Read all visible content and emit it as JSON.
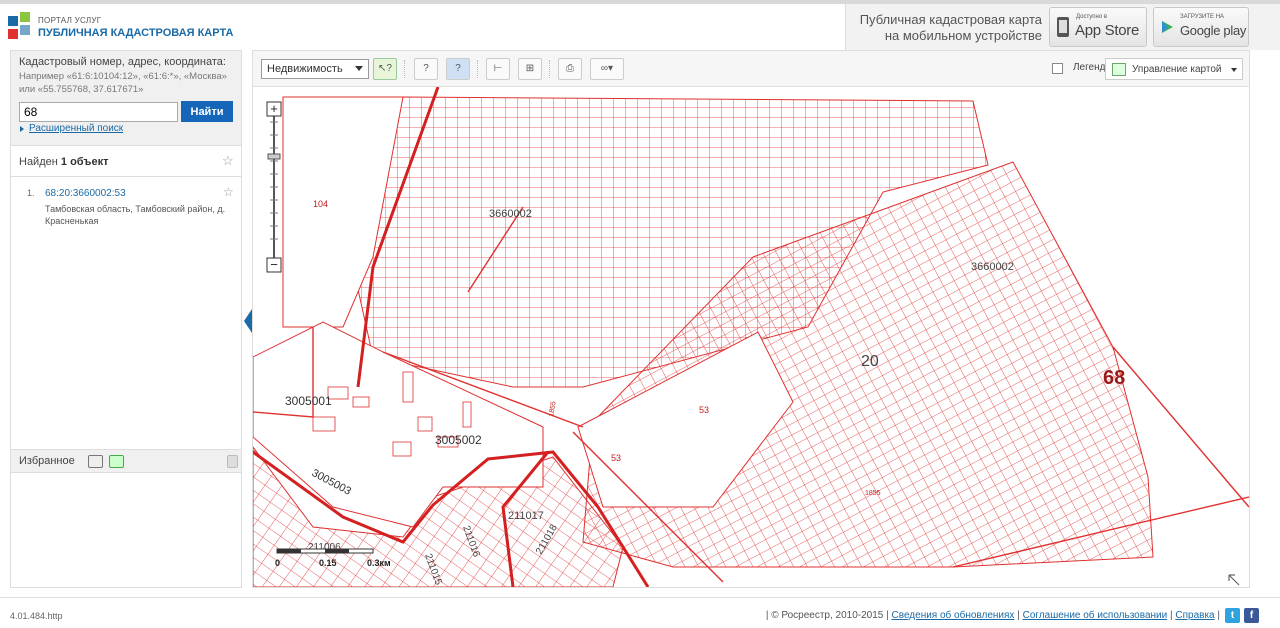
{
  "header": {
    "brand_line1": "ПОРТАЛ УСЛУГ",
    "brand_line2": "ПУБЛИЧНАЯ КАДАСТРОВАЯ КАРТА",
    "promo_text": "Публичная кадастровая карта на мобильном устройстве",
    "appstore_small": "Доступно в",
    "appstore_big": "App Store",
    "gplay_small": "ЗАГРУЗИТЕ НА",
    "gplay_big": "Google play"
  },
  "search": {
    "label": "Кадастровый номер, адрес, координата:",
    "example": "Например «61:6:10104:12», «61:6:*», «Москва» или «55.755768, 37.617671»",
    "value": "68",
    "button": "Найти",
    "advanced": "Расширенный поиск"
  },
  "results": {
    "found_prefix": "Найден",
    "found_count": "1 объект",
    "items": [
      {
        "num": "1.",
        "number": "68:20:3660002:53",
        "address": "Тамбовская область, Тамбовский район, д. Красненькая"
      }
    ]
  },
  "favorites": {
    "label": "Избранное"
  },
  "toolbar": {
    "dropdown": "Недвижимость",
    "legend": "Легенда",
    "map_control": "Управление картой"
  },
  "map": {
    "labels": {
      "l104": "104",
      "l3660002a": "3660002",
      "l3660002b": "3660002",
      "l20": "20",
      "l68": "68",
      "l53a": "53",
      "l53b": "53",
      "l1855a": "1855",
      "l1855b": "1855",
      "l3005001": "3005001",
      "l3005002": "3005002",
      "l3005003": "3005003",
      "l211017": "211017",
      "l211016": "211016",
      "l211006": "211006",
      "l211015": "211015",
      "l211018": "211018"
    },
    "scale": {
      "s0": "0",
      "s1": "0.15",
      "s2": "0.3км"
    }
  },
  "footer": {
    "version": "4.01.484.http",
    "copyright": "| © Росреестр, 2010-2015 |",
    "link_updates": "Сведения об обновлениях",
    "link_terms": "Соглашение об использовании",
    "link_help": "Справка",
    "sep": "|"
  },
  "colors": {
    "cadastre_red": "#e03030",
    "brand_blue": "#1565b8"
  }
}
